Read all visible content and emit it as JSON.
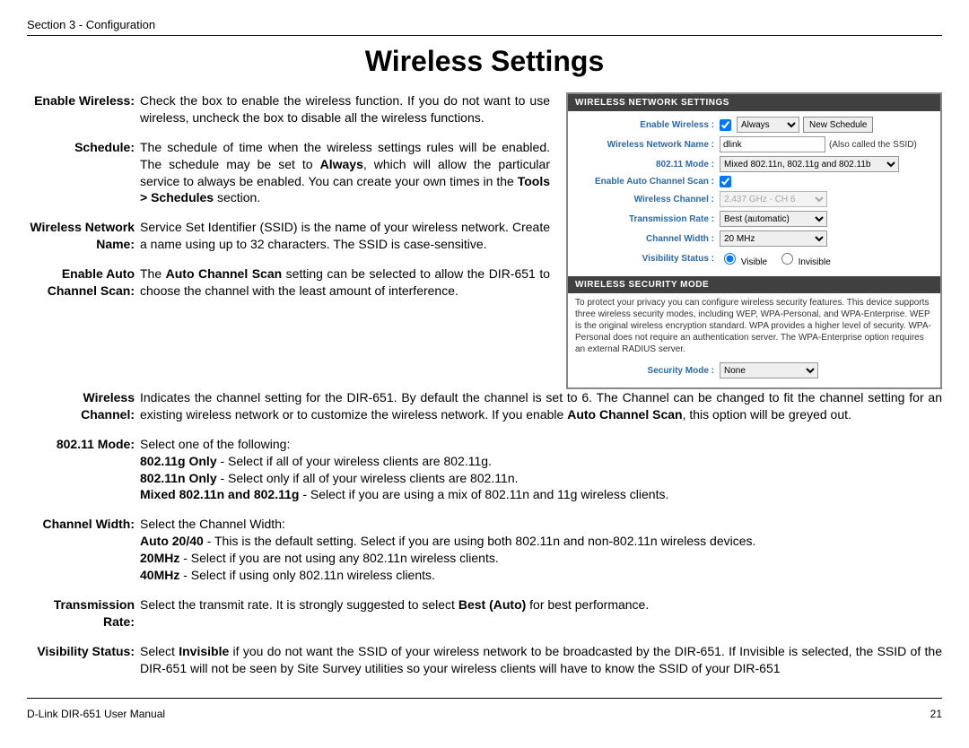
{
  "header": {
    "section": "Section 3 - Configuration",
    "title": "Wireless Settings"
  },
  "defs": {
    "enable_wireless": {
      "label1": "Enable Wireless:",
      "body": "Check the box to enable the wireless function. If you do not want to use wireless, uncheck the box to disable all the wireless functions."
    },
    "schedule": {
      "label1": "Schedule:",
      "body_pre": "The schedule of time when the wireless settings rules will be enabled. The schedule may be set to ",
      "always": "Always",
      "body_mid": ", which will allow the particular service to always be enabled. You can create your own times in the ",
      "tools": "Tools > Schedules",
      "body_post": " section."
    },
    "wnn": {
      "label1": "Wireless Network",
      "label2": "Name:",
      "body": "Service Set Identifier (SSID) is the name of your wireless network. Create a name using up to 32 characters. The SSID is case-sensitive."
    },
    "eacs": {
      "label1": "Enable Auto",
      "label2": "Channel Scan:",
      "body_pre": "The ",
      "bold": "Auto Channel Scan",
      "body_post": " setting can be selected to allow the DIR-651 to choose the channel with the least amount of interference."
    },
    "wc": {
      "label1": "Wireless",
      "label2": "Channel:",
      "body_pre": "Indicates the channel setting for the DIR-651. By default the channel is set to 6. The Channel can be changed to fit the channel setting for an existing wireless network or to customize the wireless network. If you enable ",
      "bold": "Auto Channel Scan",
      "body_post": ", this option will be greyed out."
    },
    "mode": {
      "label1": "802.11 Mode:",
      "intro": "Select one of the following:",
      "g_b": "802.11g Only",
      "g_t": " - Select if all of your wireless clients are 802.11g.",
      "n_b": "802.11n Only",
      "n_t": " - Select only if all of your wireless clients are 802.11n.",
      "m_b": "Mixed 802.11n and 802.11g",
      "m_t": " - Select if you are using a mix of 802.11n and 11g wireless clients."
    },
    "cw": {
      "label1": "Channel Width:",
      "intro": "Select the Channel Width:",
      "a_b": "Auto 20/40",
      "a_t": " - This is the default setting. Select if you are using both 802.11n and non-802.11n wireless devices.",
      "b_b": "20MHz",
      "b_t": " - Select if you are not using any 802.11n wireless clients.",
      "c_b": "40MHz",
      "c_t": " - Select if using only 802.11n wireless clients."
    },
    "tr": {
      "label1": "Transmission",
      "label2": "Rate:",
      "pre": "Select the transmit rate. It is strongly suggested to select ",
      "bold": "Best (Auto)",
      "post": " for best performance."
    },
    "vs": {
      "label1": "Visibility Status:",
      "pre": "Select ",
      "bold": "Invisible",
      "post": " if you do not want the SSID of your wireless network to be broadcasted by the DIR-651. If Invisible is selected, the SSID of the DIR-651 will not be seen by Site Survey utilities so your wireless clients will have to know the SSID of your DIR-651"
    }
  },
  "panel": {
    "h1": "WIRELESS NETWORK SETTINGS",
    "enable_wireless_label": "Enable Wireless :",
    "schedule_value": "Always",
    "new_schedule_btn": "New Schedule",
    "wnn_label": "Wireless Network Name :",
    "wnn_value": "dlink",
    "wnn_hint": "(Also called the SSID)",
    "mode_label": "802.11 Mode :",
    "mode_value": "Mixed 802.11n, 802.11g and 802.11b",
    "eacs_label": "Enable Auto Channel Scan :",
    "wc_label": "Wireless Channel :",
    "wc_value": "2.437 GHz - CH 6",
    "tr_label": "Transmission Rate :",
    "tr_value": "Best (automatic)",
    "cw_label": "Channel Width :",
    "cw_value": "20 MHz",
    "vs_label": "Visibility Status :",
    "vs_visible": "Visible",
    "vs_invisible": "Invisible",
    "h2": "WIRELESS SECURITY MODE",
    "sec_desc": "To protect your privacy you can configure wireless security features. This device supports three wireless security modes, including WEP, WPA-Personal, and WPA-Enterprise. WEP is the original wireless encryption standard. WPA provides a higher level of security. WPA-Personal does not require an authentication server. The WPA-Enterprise option requires an external RADIUS server.",
    "sec_mode_label": "Security Mode :",
    "sec_mode_value": "None"
  },
  "footer": {
    "left": "D-Link DIR-651 User Manual",
    "right": "21"
  }
}
